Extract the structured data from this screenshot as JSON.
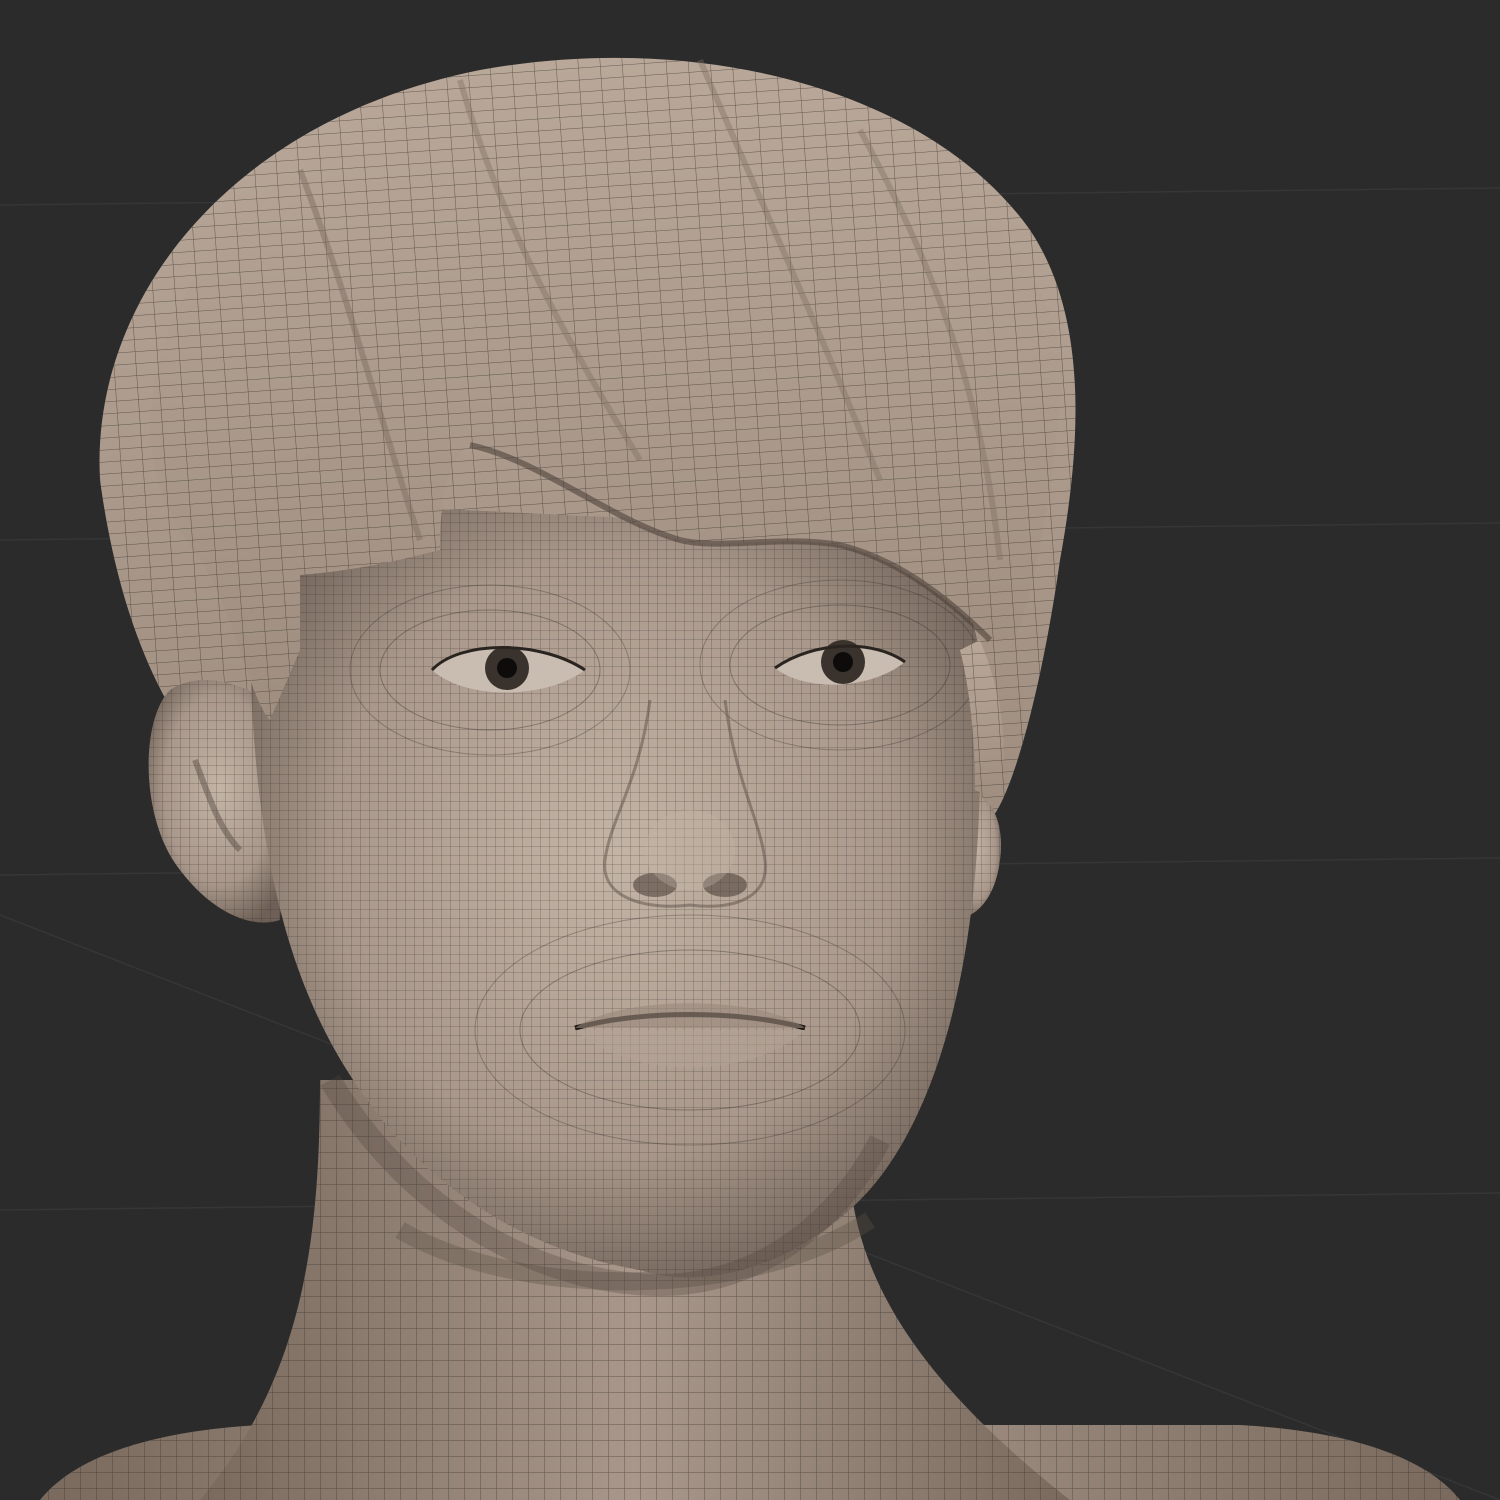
{
  "viewport": {
    "background_color": "#2b2b2b",
    "grid_line_color": "#363636"
  },
  "model": {
    "skin_color": "#a8978a",
    "skin_light": "#c4b4a6",
    "skin_shadow": "#6e6056",
    "hair_color": "#9f8e80",
    "hair_light": "#b9a899",
    "wire_color": "#2a2420",
    "iris_color": "#3a322c",
    "pupil_color": "#0e0c0b",
    "eye_white": "#c9bcb0"
  }
}
